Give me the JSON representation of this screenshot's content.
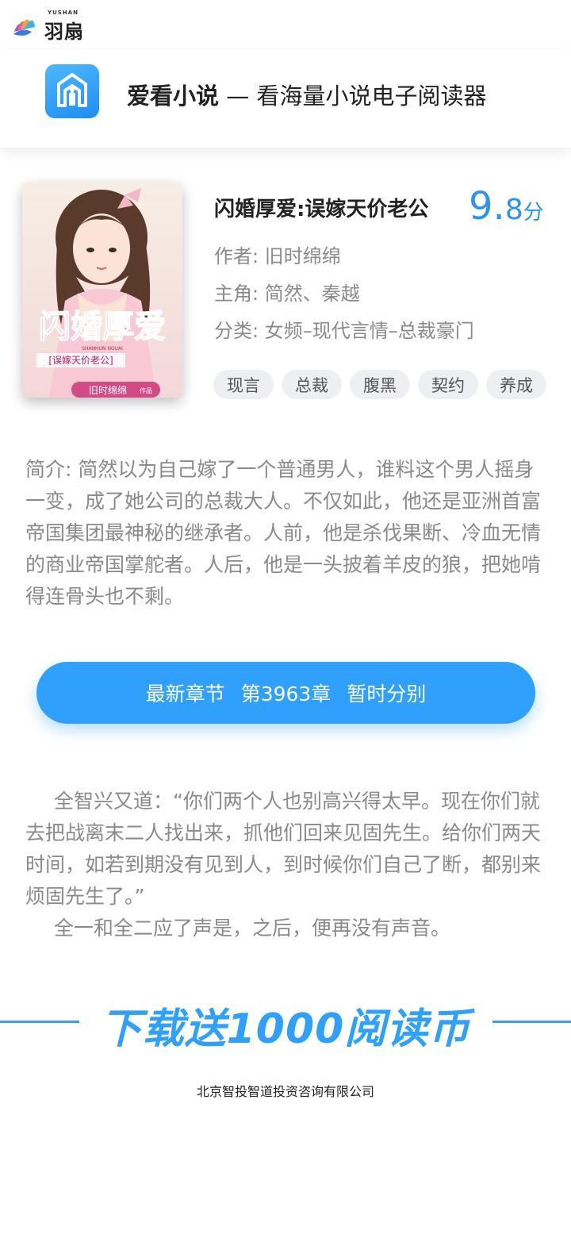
{
  "brand": {
    "small": "YUSHAN",
    "name": "羽扇"
  },
  "app": {
    "name": "爱看小说",
    "dash": "—",
    "slogan": "看海量小说电子阅读器",
    "accent_color": "#2fa0fb"
  },
  "book": {
    "title": "闪婚厚爱:误嫁天价老公",
    "rating_int": "9",
    "rating_dot": ".",
    "rating_dec": "8",
    "rating_unit": "分",
    "author_label": "作者: ",
    "author": "旧时绵绵",
    "protagonist_label": "主角: ",
    "protagonist": "简然、秦越",
    "category_label": "分类: ",
    "category": "女频–现代言情–总裁豪门",
    "tags": [
      "现言",
      "总裁",
      "腹黑",
      "契约",
      "养成"
    ],
    "cover": {
      "title": "闪婚厚爱",
      "subtitle": "[误嫁天价老公]",
      "pinyin": "SHANHUN HOUAI",
      "author_text": "旧时绵绵",
      "author_suffix": "作品"
    }
  },
  "synopsis": "简介: 简然以为自己嫁了一个普通男人，谁料这个男人摇身一变，成了她公司的总裁大人。不仅如此，他还是亚洲首富帝国集团最神秘的继承者。人前，他是杀伐果断、冷血无情的商业帝国掌舵者。人后，他是一头披着羊皮的狼，把她啃得连骨头也不剩。",
  "latest_chapter": {
    "label": "最新章节",
    "number": "第3963章",
    "name": "暂时分别"
  },
  "excerpt": {
    "paragraph1": "全智兴又道：“你们两个人也别高兴得太早。现在你们就去把战离末二人找出来，抓他们回来见固先生。给你们两天时间，如若到期没有见到人，到时候你们自己了断，都别来烦固先生了。”",
    "paragraph2": "全一和全二应了声是，之后，便再没有声音。"
  },
  "download_banner": "下载送1000阅读币",
  "company": "北京智投智道投资咨询有限公司"
}
